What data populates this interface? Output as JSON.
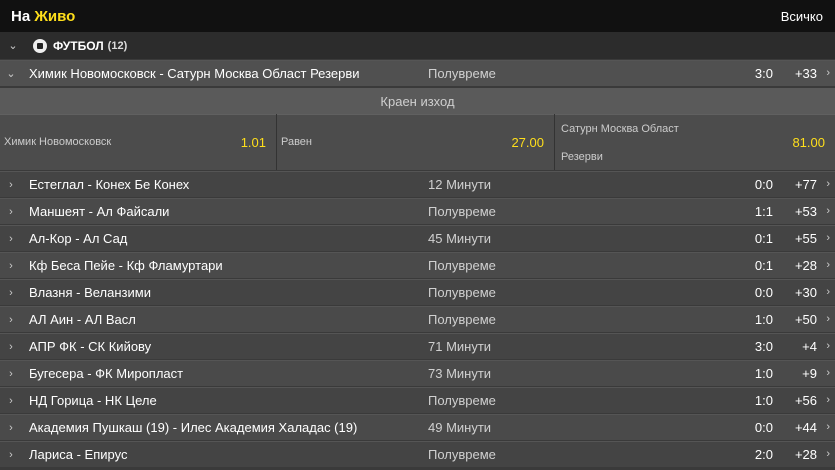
{
  "header": {
    "title_prefix": "На",
    "title_accent": "Живо",
    "all_label": "Всичко"
  },
  "sport": {
    "name": "ФУТБОЛ",
    "count": "(12)"
  },
  "expanded_match": {
    "name": "Химик Новомосковск - Сатурн Москва Област Резерви",
    "time": "Полувреме",
    "score": "3:0",
    "more": "+33",
    "market_title": "Краен изход",
    "home_label": "Химик Новомосковск",
    "home_price": "1.01",
    "draw_label": "Равен",
    "draw_price": "27.00",
    "away_label_line1": "Сатурн Москва Област",
    "away_label_line2": "Резерви",
    "away_price": "81.00"
  },
  "matches": [
    {
      "name": "Естеглал - Конех Бе Конех",
      "time": "12 Минути",
      "score": "0:0",
      "more": "+77"
    },
    {
      "name": "Маншеят - Ал Файсали",
      "time": "Полувреме",
      "score": "1:1",
      "more": "+53"
    },
    {
      "name": "Ал-Кор - Ал Сад",
      "time": "45 Минути",
      "score": "0:1",
      "more": "+55"
    },
    {
      "name": "Кф Беса Пейе - Кф Фламуртари",
      "time": "Полувреме",
      "score": "0:1",
      "more": "+28"
    },
    {
      "name": "Влазня - Веланзими",
      "time": "Полувреме",
      "score": "0:0",
      "more": "+30"
    },
    {
      "name": "АЛ Аин - АЛ Васл",
      "time": "Полувреме",
      "score": "1:0",
      "more": "+50"
    },
    {
      "name": "АПР ФК - СК Кийову",
      "time": "71 Минути",
      "score": "3:0",
      "more": "+4"
    },
    {
      "name": "Бугесера - ФК Миропласт",
      "time": "73 Минути",
      "score": "1:0",
      "more": "+9"
    },
    {
      "name": "НД Горица - НК Целе",
      "time": "Полувреме",
      "score": "1:0",
      "more": "+56"
    },
    {
      "name": "Академия Пушкаш (19) - Илес Академия Халадас (19)",
      "time": "49 Минути",
      "score": "0:0",
      "more": "+44"
    },
    {
      "name": "Лариса - Епирус",
      "time": "Полувреме",
      "score": "2:0",
      "more": "+28"
    }
  ],
  "colors": {
    "accent": "#ffdf1b",
    "header_bg": "#111111",
    "row_bg": "#444444"
  },
  "icons": {
    "collapse": "chevron-down-icon",
    "expand": "chevron-right-icon",
    "sport": "soccer-ball-icon"
  }
}
